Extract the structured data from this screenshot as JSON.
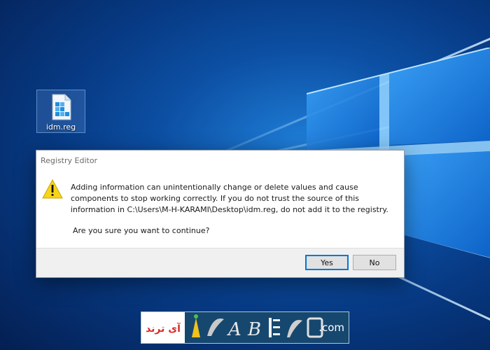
{
  "desktop": {
    "icon_label": "idm.reg"
  },
  "dialog": {
    "title": "Registry Editor",
    "message": "Adding information can unintentionally change or delete values and cause components to stop working correctly. If you do not trust the source of this information in C:\\Users\\M-H-KARAMI\\Desktop\\idm.reg, do not add it to the registry.",
    "question": "Are you sure you want to continue?",
    "yes_label": "Yes",
    "no_label": "No"
  },
  "watermark": {
    "brand": "آی ترند",
    "suffix": ".com"
  },
  "colors": {
    "desktop_blue": "#0c4fa3",
    "warning_yellow": "#f7d417",
    "accent": "#0078d7"
  }
}
